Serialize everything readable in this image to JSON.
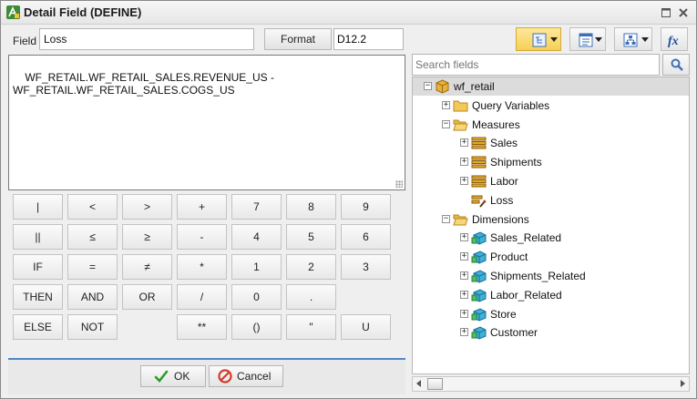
{
  "window": {
    "title": "Detail Field (DEFINE)"
  },
  "form": {
    "field_label": "Field",
    "field_value": "Loss",
    "format_button": "Format",
    "format_value": "D12.2",
    "expression": "WF_RETAIL.WF_RETAIL_SALES.REVENUE_US -\nWF_RETAIL.WF_RETAIL_SALES.COGS_US"
  },
  "keypad": [
    [
      "|",
      "<",
      ">",
      "+",
      "7",
      "8",
      "9"
    ],
    [
      "||",
      "≤",
      "≥",
      "-",
      "4",
      "5",
      "6"
    ],
    [
      "IF",
      "=",
      "≠",
      "*",
      "1",
      "2",
      "3"
    ],
    [
      "THEN",
      "AND",
      "OR",
      "/",
      "0",
      ".",
      ""
    ],
    [
      "ELSE",
      "NOT",
      "",
      "**",
      "()",
      "\"",
      "U"
    ]
  ],
  "buttons": {
    "ok": "OK",
    "cancel": "Cancel"
  },
  "search": {
    "placeholder": "Search fields"
  },
  "tree": {
    "root": "wf_retail",
    "items": [
      {
        "label": "wf_retail",
        "level": 0,
        "icon": "cube-icon",
        "expander": "−",
        "selected": true
      },
      {
        "label": "Query Variables",
        "level": 1,
        "icon": "folder-icon",
        "expander": "+"
      },
      {
        "label": "Measures",
        "level": 1,
        "icon": "folder-open-icon",
        "expander": "−"
      },
      {
        "label": "Sales",
        "level": 2,
        "icon": "measure-group-icon",
        "expander": "+"
      },
      {
        "label": "Shipments",
        "level": 2,
        "icon": "measure-group-icon",
        "expander": "+"
      },
      {
        "label": "Labor",
        "level": 2,
        "icon": "measure-group-icon",
        "expander": "+"
      },
      {
        "label": "Loss",
        "level": 2,
        "icon": "computed-field-icon",
        "expander": ""
      },
      {
        "label": "Dimensions",
        "level": 1,
        "icon": "folder-open-icon",
        "expander": "−"
      },
      {
        "label": "Sales_Related",
        "level": 2,
        "icon": "dimension-icon",
        "expander": "+"
      },
      {
        "label": "Product",
        "level": 2,
        "icon": "dimension-icon",
        "expander": "+"
      },
      {
        "label": "Shipments_Related",
        "level": 2,
        "icon": "dimension-icon",
        "expander": "+"
      },
      {
        "label": "Labor_Related",
        "level": 2,
        "icon": "dimension-icon",
        "expander": "+"
      },
      {
        "label": "Store",
        "level": 2,
        "icon": "dimension-icon",
        "expander": "+"
      },
      {
        "label": "Customer",
        "level": 2,
        "icon": "dimension-icon",
        "expander": "+"
      }
    ]
  },
  "colors": {
    "accent": "#4f86c6",
    "toolbar_active": "#f6cf55"
  }
}
